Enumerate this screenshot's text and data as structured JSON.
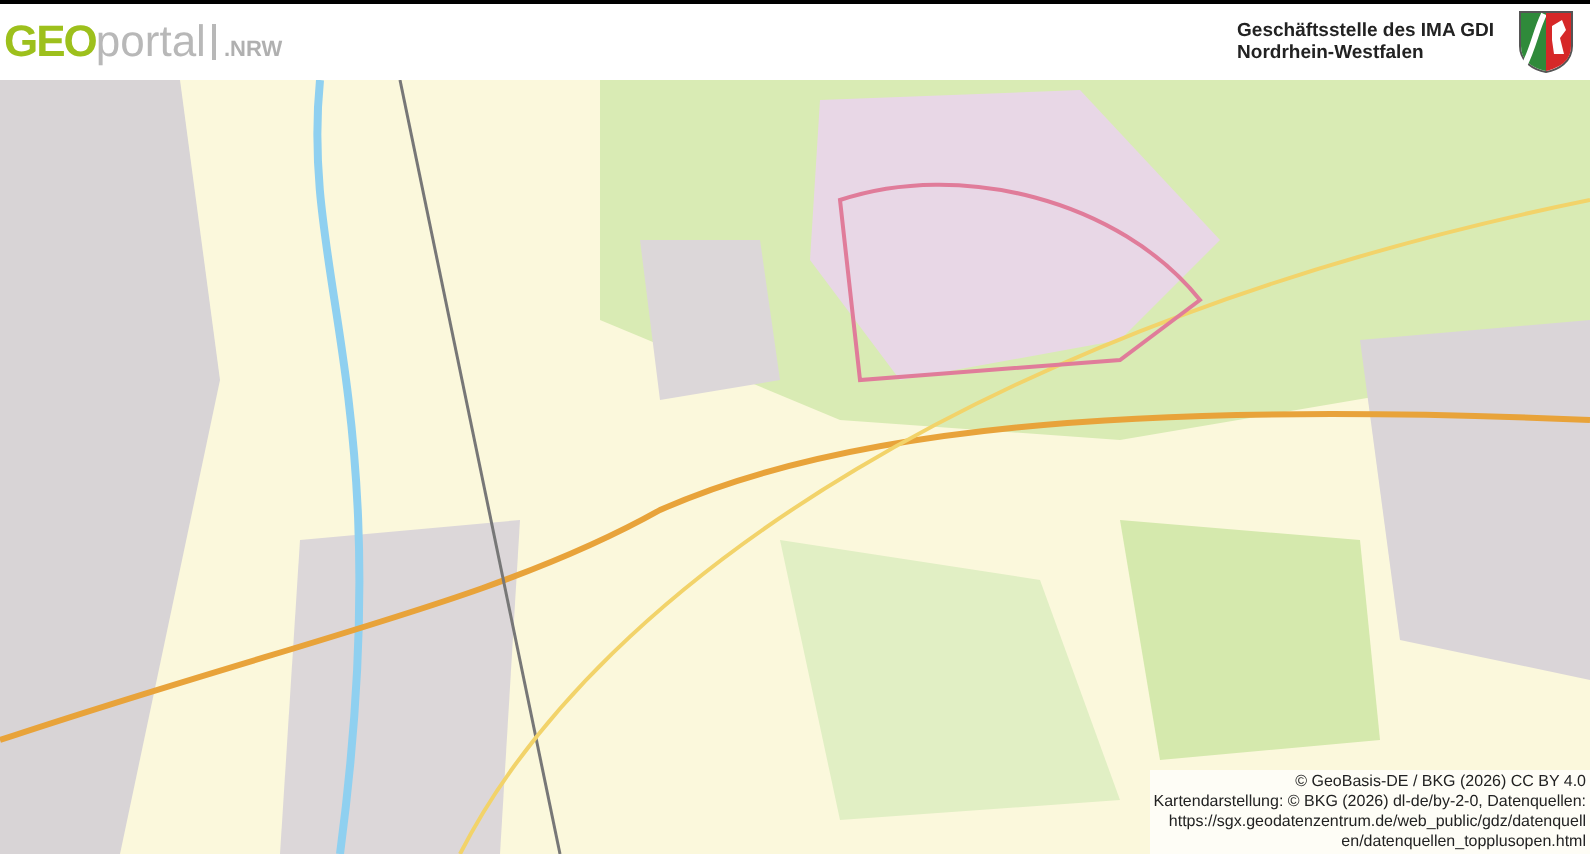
{
  "header": {
    "logo": {
      "part_1": "GEO",
      "part_2": "portal",
      "part_3": ".NRW"
    },
    "agency": [
      "Geschäftsstelle des IMA GDI",
      "Nordrhein-Westfalen"
    ]
  },
  "map": {
    "kind": "picture",
    "attribution": [
      "© GeoBasis-DE / BKG (2026) CC BY 4.0",
      "Kartendarstellung: © BKG (2026) dl-de/by-2-0, Datenquellen:",
      "https://sgx.geodatenzentrum.de/web_public/gdz/datenquell",
      "en/datenquellen_topplusopen.html"
    ]
  }
}
